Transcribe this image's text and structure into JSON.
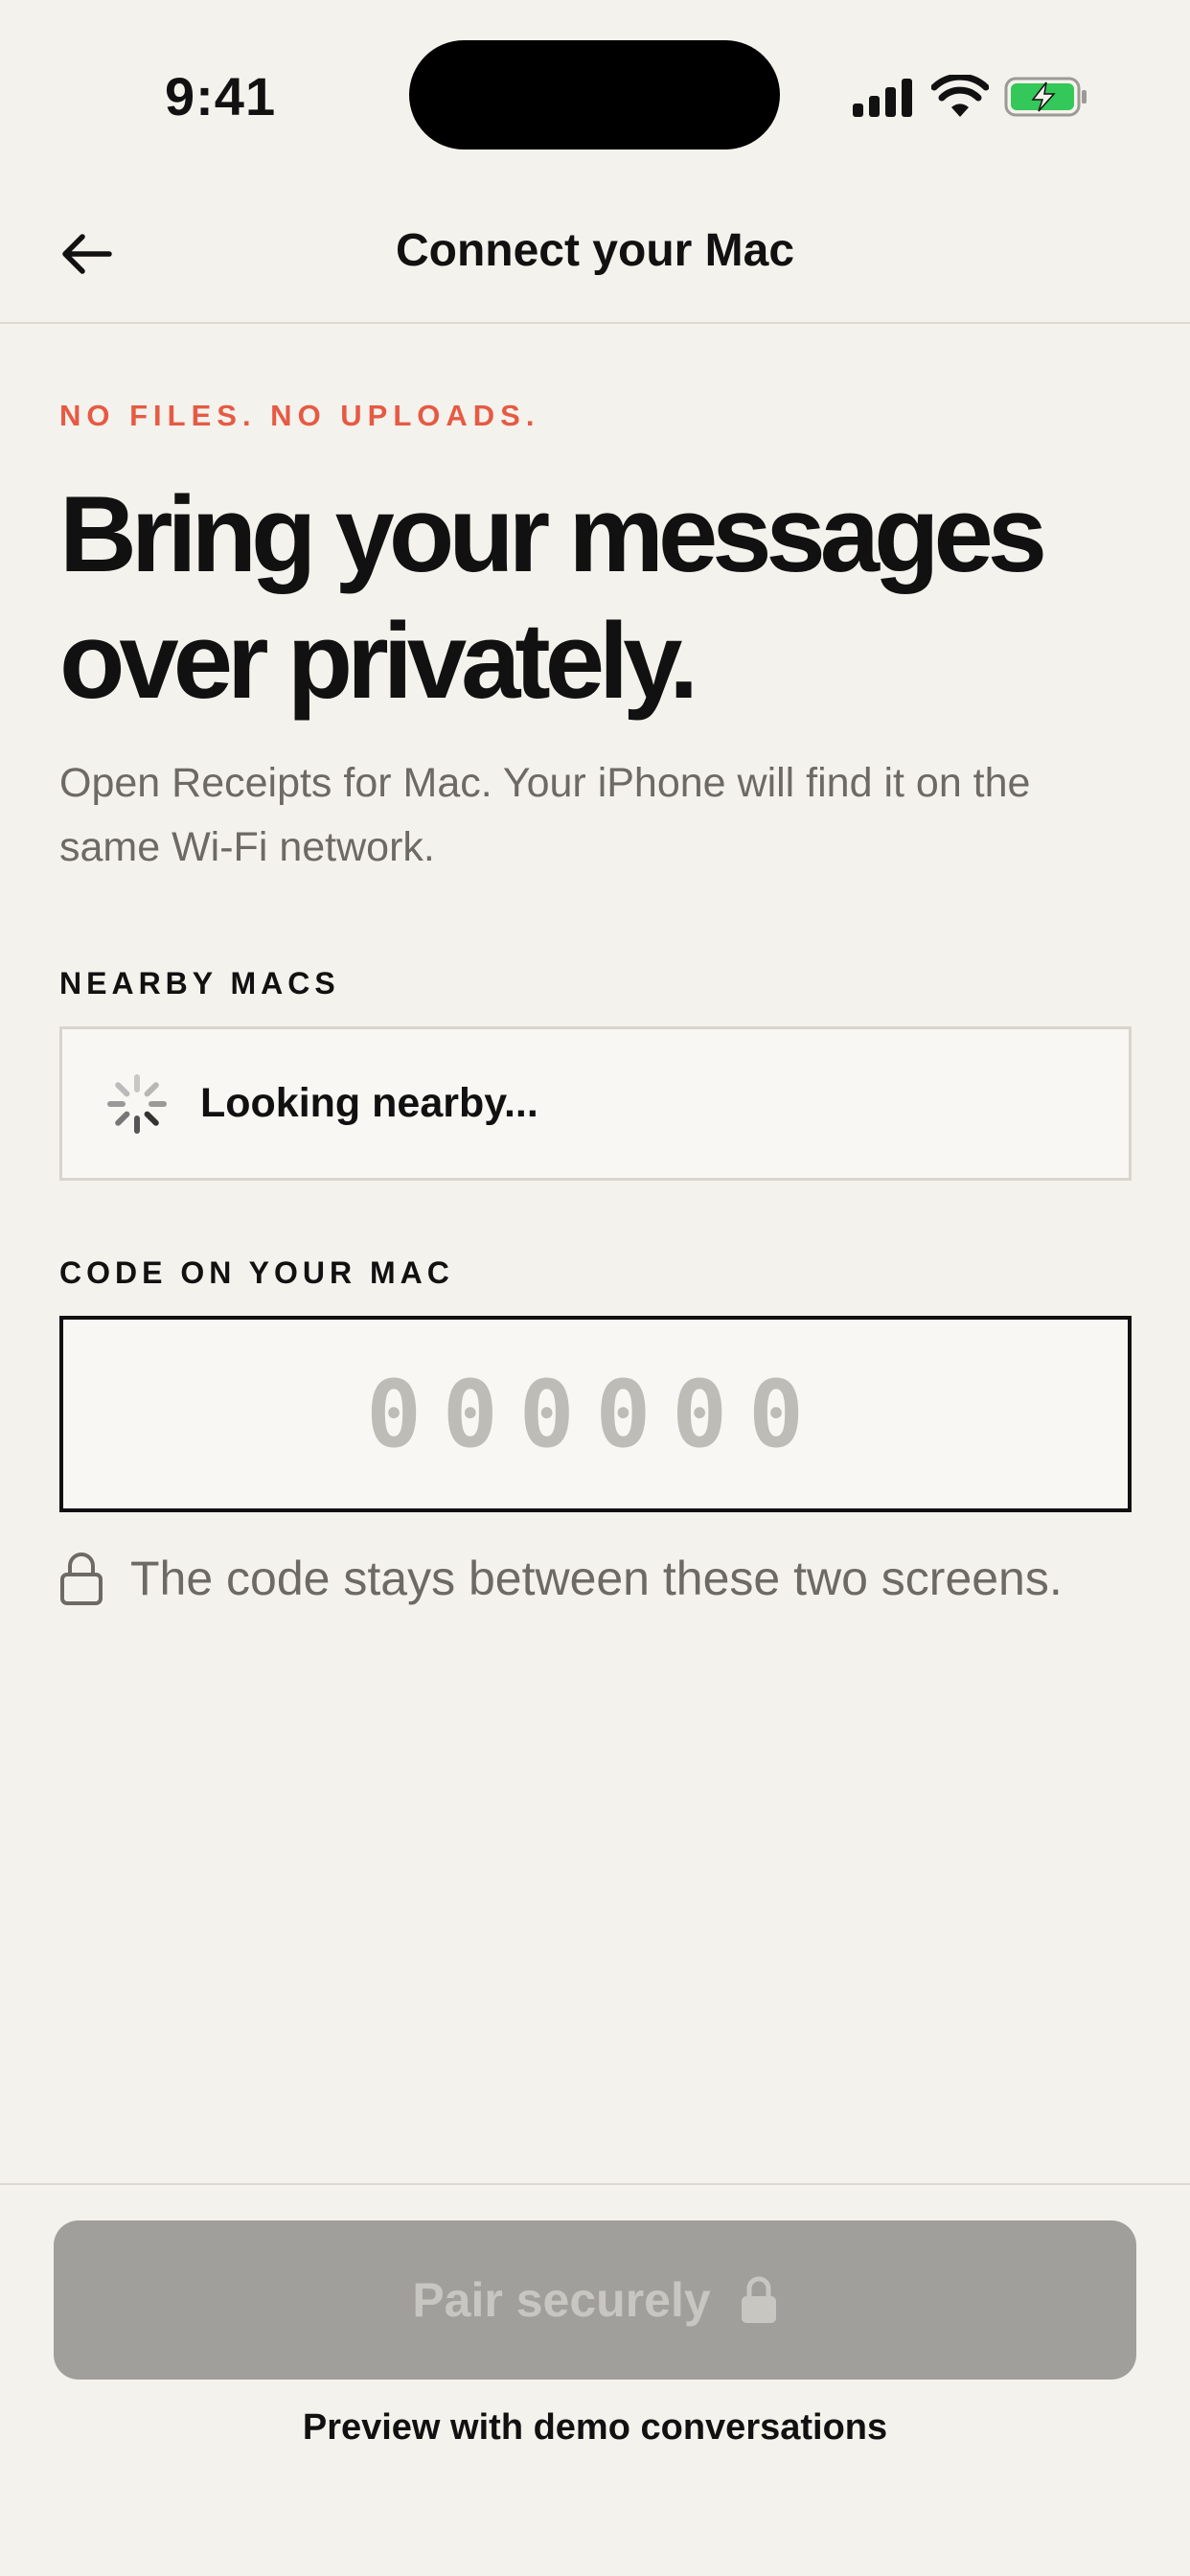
{
  "status_bar": {
    "time": "9:41",
    "icons": [
      "cellular-signal-icon",
      "wifi-icon",
      "battery-charging-icon"
    ],
    "battery_color": "#34c759"
  },
  "nav": {
    "title": "Connect your Mac",
    "back_icon": "arrow-left-icon"
  },
  "intro": {
    "eyebrow": "NO FILES. NO UPLOADS.",
    "headline": "Bring your messages over privately.",
    "subtitle": "Open Receipts for Mac. Your iPhone will find it on the same Wi-Fi network."
  },
  "nearby": {
    "label": "NEARBY MACS",
    "status": "Looking nearby..."
  },
  "code": {
    "label": "CODE ON YOUR MAC",
    "placeholder": "000000",
    "note": "The code stays between these two screens."
  },
  "actions": {
    "pair_label": "Pair securely",
    "demo_label": "Preview with demo conversations"
  },
  "colors": {
    "background": "#f4f2ec",
    "accent": "#e65a44",
    "button_disabled": "#a19f9b"
  }
}
